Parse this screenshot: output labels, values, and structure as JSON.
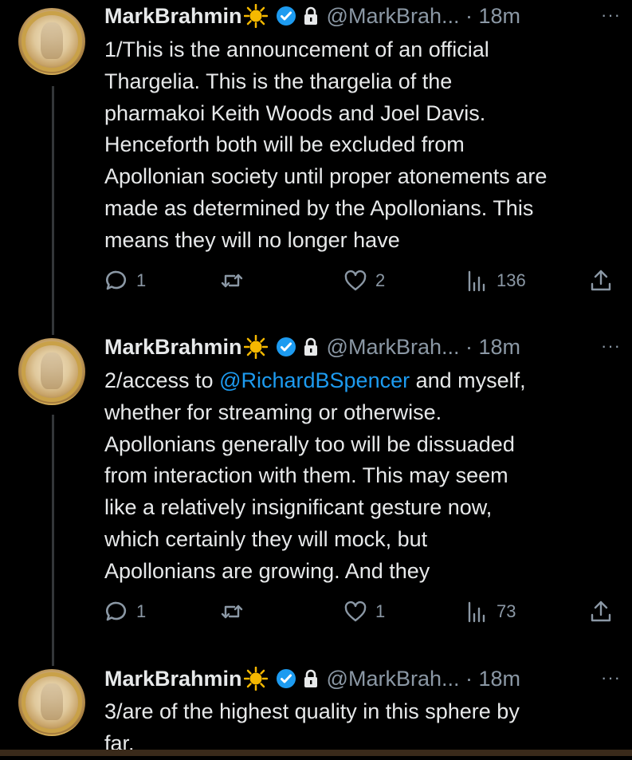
{
  "tweets": [
    {
      "name": "MarkBrahmin",
      "handle": "@MarkBrah... · 18m",
      "more": "···",
      "text_lines": [
        "1/This is the announcement of an official",
        "Thargelia. This is the thargelia of the",
        "pharmakoi Keith Woods and Joel Davis.",
        "Henceforth both will be excluded from",
        "Apollonian society until proper atonements are",
        "made as determined by the Apollonians. This",
        "means they will no longer have"
      ],
      "replies": "1",
      "retweets": "",
      "likes": "2",
      "views": "136"
    },
    {
      "name": "MarkBrahmin",
      "handle": "@MarkBrah... · 18m",
      "more": "···",
      "line1_prefix": "2/access to ",
      "line1_mention": "@RichardBSpencer",
      "line1_suffix": " and myself,",
      "text_lines": [
        "whether for streaming or otherwise.",
        "Apollonians generally too will be dissuaded",
        "from interaction with them. This may seem",
        "like a relatively insignificant gesture now,",
        "which certainly they will mock, but",
        "Apollonians are growing. And they"
      ],
      "replies": "1",
      "retweets": "",
      "likes": "1",
      "views": "73"
    },
    {
      "name": "MarkBrahmin",
      "handle": "@MarkBrah... · 18m",
      "more": "···",
      "text_lines": [
        "3/are of the highest quality in this sphere by",
        "far."
      ]
    }
  ],
  "colors": {
    "background": "#000000",
    "text": "#e7e9ea",
    "secondary": "#8b98a5",
    "link": "#1d9bf0",
    "verified": "#1d9bf0",
    "sun": "#f5b800"
  },
  "icons": [
    "sun-emoji-icon",
    "verified-badge-icon",
    "lock-icon",
    "reply-icon",
    "retweet-icon",
    "like-icon",
    "views-icon",
    "share-icon"
  ]
}
